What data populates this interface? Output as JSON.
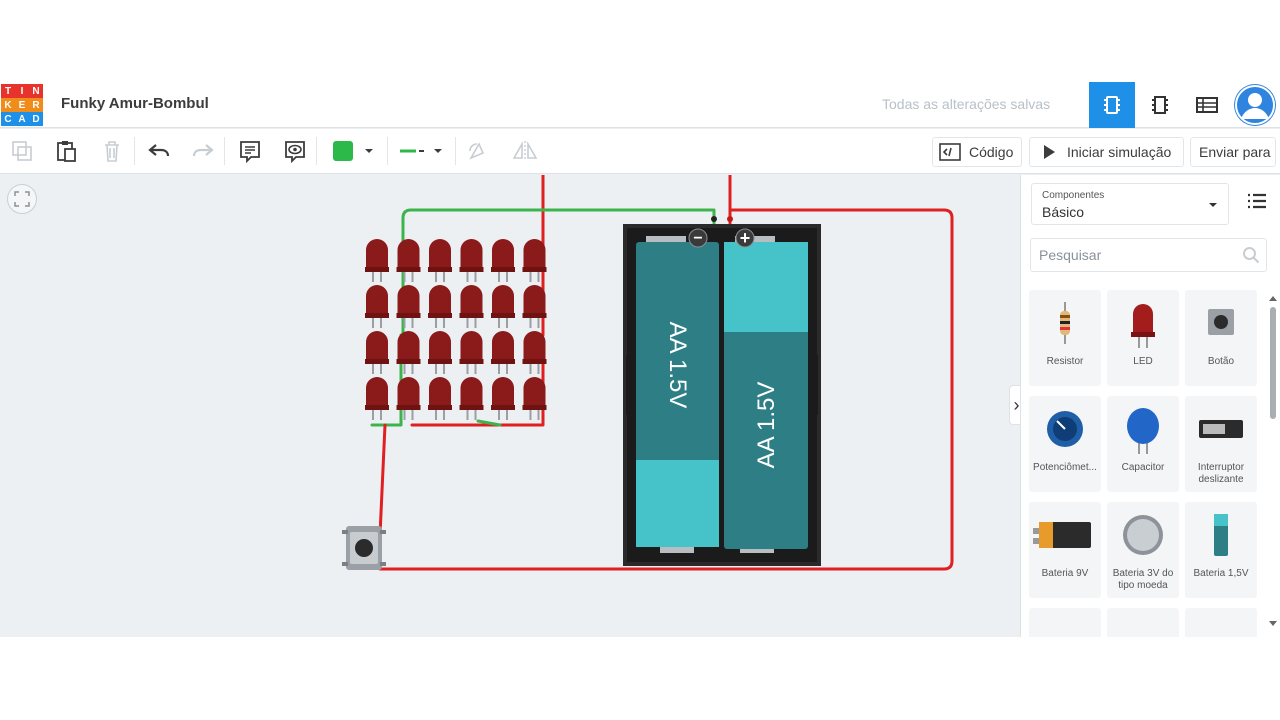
{
  "header": {
    "logo_letters": [
      "T",
      "I",
      "N",
      "K",
      "E",
      "R",
      "C",
      "A",
      "D"
    ],
    "logo_colors": [
      "#e8332c",
      "#e8332c",
      "#e8332c",
      "#f08c1a",
      "#f08c1a",
      "#f08c1a",
      "#1e90e8",
      "#1e90e8",
      "#1e90e8"
    ],
    "project_title": "Funky Amur-Bombul",
    "save_status": "Todas as alterações salvas",
    "view_buttons": [
      "circuit-view-icon",
      "schematic-view-icon",
      "component-list-icon"
    ],
    "active_view_color": "#1e90e8"
  },
  "toolbar": {
    "left_icons": [
      "copy-icon",
      "paste-icon",
      "delete-icon",
      "undo-icon",
      "redo-icon",
      "notes-icon",
      "visibility-icon",
      "wire-color-swatch",
      "wire-type-selector",
      "rotate-icon",
      "flip-icon"
    ],
    "wire_color": "#2db84a",
    "code_label": "Código",
    "start_sim_label": "Iniciar simulação",
    "send_to_label": "Enviar para"
  },
  "canvas": {
    "battery_labels": [
      "AA 1.5V",
      "AA 1.5V"
    ],
    "battery_terminal_minus": "−",
    "battery_terminal_plus": "+",
    "wire_red": "#e02020",
    "wire_green": "#3cb44b",
    "led_color": "#8b1a1a"
  },
  "panel": {
    "category_label": "Componentes",
    "category_value": "Básico",
    "search_placeholder": "Pesquisar",
    "components": [
      {
        "label": "Resistor",
        "icon": "resistor-icon"
      },
      {
        "label": "LED",
        "icon": "led-icon"
      },
      {
        "label": "Botão",
        "icon": "pushbutton-icon"
      },
      {
        "label": "Potenciômet...",
        "icon": "potentiometer-icon"
      },
      {
        "label": "Capacitor",
        "icon": "capacitor-icon"
      },
      {
        "label": "Interruptor deslizante",
        "icon": "slide-switch-icon"
      },
      {
        "label": "Bateria 9V",
        "icon": "battery-9v-icon"
      },
      {
        "label": "Bateria 3V do tipo moeda",
        "icon": "coin-battery-icon"
      },
      {
        "label": "Bateria 1,5V",
        "icon": "battery-1-5v-icon"
      }
    ]
  }
}
